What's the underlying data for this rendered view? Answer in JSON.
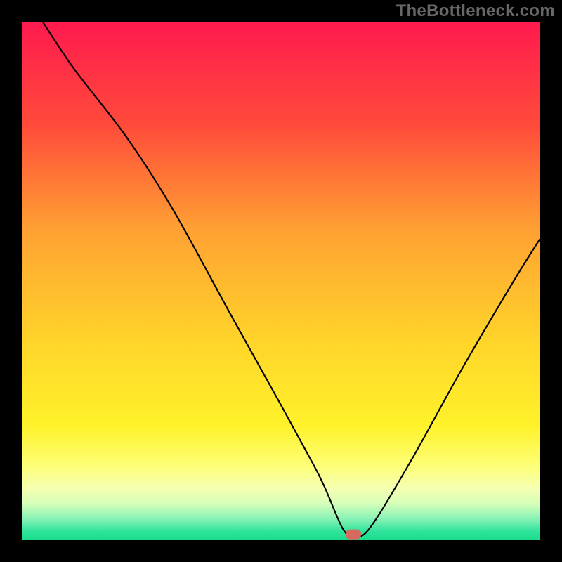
{
  "watermark": "TheBottleneck.com",
  "chart_data": {
    "type": "line",
    "title": "",
    "xlabel": "",
    "ylabel": "",
    "xlim": [
      0,
      100
    ],
    "ylim": [
      0,
      100
    ],
    "grid": false,
    "series": [
      {
        "name": "curve",
        "x": [
          4,
          10,
          20,
          29,
          40,
          50,
          56,
          58.5,
          62,
          64,
          67,
          75,
          85,
          95,
          100
        ],
        "values": [
          100,
          91,
          78,
          64,
          44,
          26,
          15,
          10,
          2,
          1,
          2,
          15,
          33,
          50,
          58
        ]
      }
    ],
    "marker": {
      "x": 64,
      "y": 1
    },
    "gradient_stops": [
      {
        "offset": 0.0,
        "color": "#ff1a4e"
      },
      {
        "offset": 0.2,
        "color": "#ff4b3a"
      },
      {
        "offset": 0.4,
        "color": "#ffa133"
      },
      {
        "offset": 0.62,
        "color": "#ffd52a"
      },
      {
        "offset": 0.78,
        "color": "#fff22a"
      },
      {
        "offset": 0.86,
        "color": "#fdff7a"
      },
      {
        "offset": 0.9,
        "color": "#f6ffb0"
      },
      {
        "offset": 0.93,
        "color": "#d6ffb8"
      },
      {
        "offset": 0.96,
        "color": "#87f2b5"
      },
      {
        "offset": 0.985,
        "color": "#2de39a"
      },
      {
        "offset": 1.0,
        "color": "#1bdc8d"
      }
    ]
  }
}
